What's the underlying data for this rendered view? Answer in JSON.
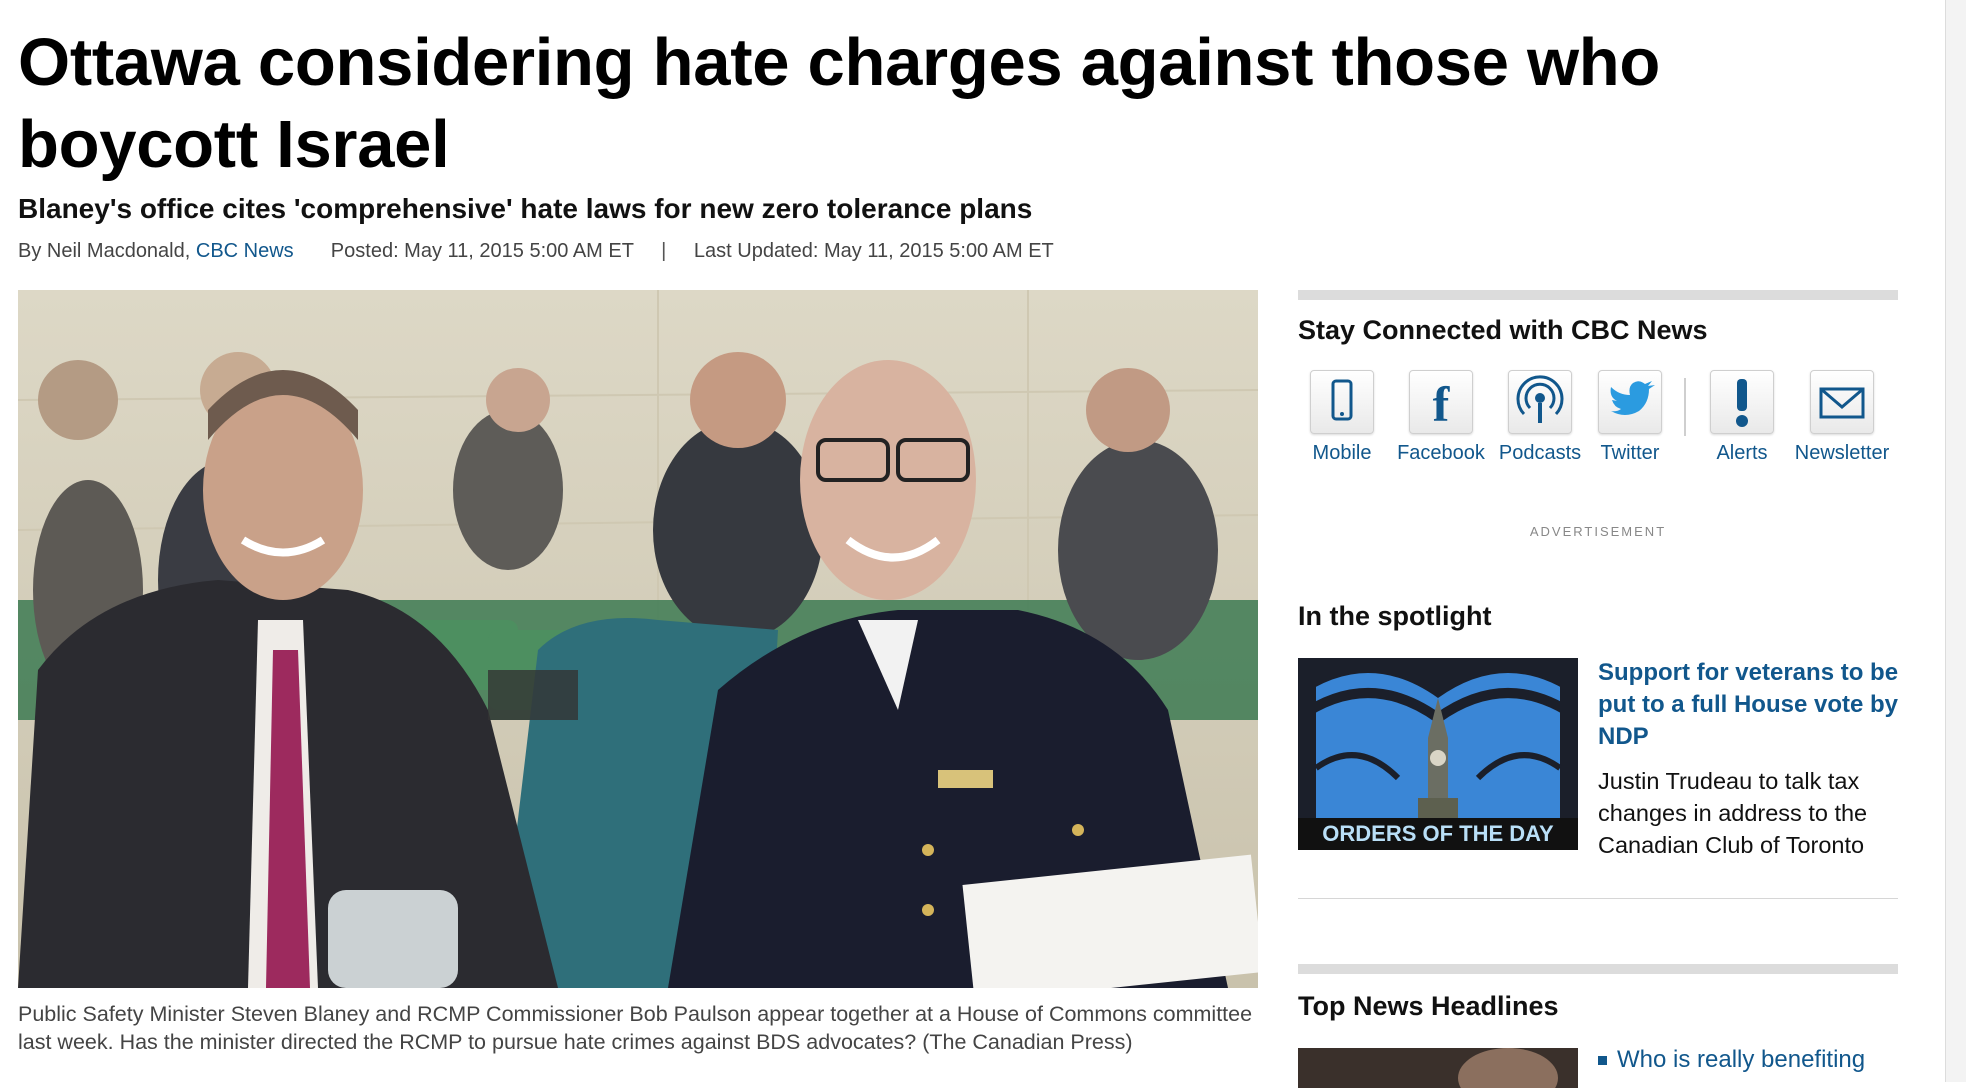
{
  "article": {
    "headline": "Ottawa considering hate charges against those who boycott Israel",
    "subheadline": "Blaney's office cites 'comprehensive' hate laws for new zero tolerance plans",
    "byline_prefix": "By Neil Macdonald,",
    "byline_source": "CBC News",
    "posted": "Posted: May 11, 2015 5:00 AM ET",
    "separator": "|",
    "updated": "Last Updated: May 11, 2015 5:00 AM ET",
    "photo_caption": "Public Safety Minister Steven Blaney and RCMP Commissioner Bob Paulson appear together at a House of Commons committee last week. Has the minister directed the RCMP to pursue hate crimes against BDS advocates? (The Canadian Press)"
  },
  "sidebar": {
    "stay_connected_title": "Stay Connected with CBC News",
    "social": [
      {
        "label": "Mobile",
        "icon": "mobile-phone-icon"
      },
      {
        "label": "Facebook",
        "icon": "facebook-icon"
      },
      {
        "label": "Podcasts",
        "icon": "podcast-icon"
      },
      {
        "label": "Twitter",
        "icon": "twitter-bird-icon"
      },
      {
        "label": "Alerts",
        "icon": "exclamation-alert-icon"
      },
      {
        "label": "Newsletter",
        "icon": "envelope-icon"
      }
    ],
    "advertisement_label": "ADVERTISEMENT",
    "spotlight_title": "In the spotlight",
    "spotlight_image_tag": "ORDERS OF THE DAY",
    "spotlight_headline": "Support for veterans to be put to a full House vote by NDP",
    "spotlight_text": "Justin Trudeau to talk tax changes in address to the Canadian Club of Toronto",
    "top_news_title": "Top News Headlines",
    "top_news_item_1": "Who is really benefiting"
  },
  "colors": {
    "link": "#11578c",
    "divider_bar": "#dcdcdc",
    "image_tag_text": "#b9dff7"
  }
}
